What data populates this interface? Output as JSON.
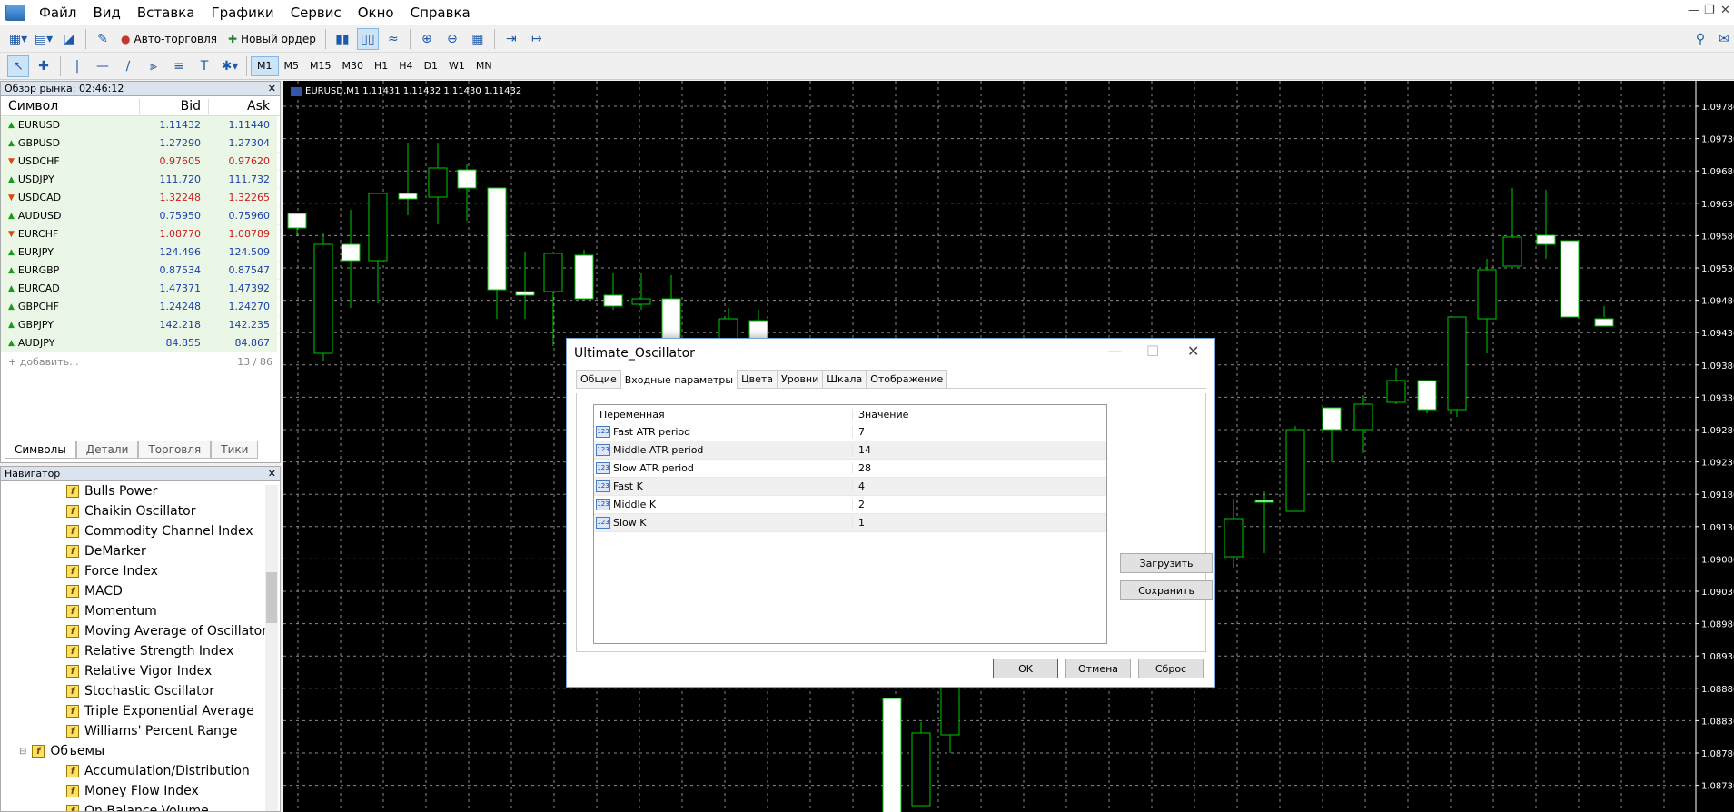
{
  "menu": [
    "Файл",
    "Вид",
    "Вставка",
    "Графики",
    "Сервис",
    "Окно",
    "Справка"
  ],
  "toolbar": {
    "auto_trading": "Авто-торговля",
    "new_order": "Новый ордер"
  },
  "timeframes": [
    "M1",
    "M5",
    "M15",
    "M30",
    "H1",
    "H4",
    "D1",
    "W1",
    "MN"
  ],
  "market_watch": {
    "title": "Обзор рынка: 02:46:12",
    "col_symbol": "Символ",
    "col_bid": "Bid",
    "col_ask": "Ask",
    "rows": [
      {
        "symbol": "EURUSD",
        "bid": "1.11432",
        "ask": "1.11440",
        "dir": "up",
        "color": "blue"
      },
      {
        "symbol": "GBPUSD",
        "bid": "1.27290",
        "ask": "1.27304",
        "dir": "up",
        "color": "blue"
      },
      {
        "symbol": "USDCHF",
        "bid": "0.97605",
        "ask": "0.97620",
        "dir": "down",
        "color": "red"
      },
      {
        "symbol": "USDJPY",
        "bid": "111.720",
        "ask": "111.732",
        "dir": "up",
        "color": "blue"
      },
      {
        "symbol": "USDCAD",
        "bid": "1.32248",
        "ask": "1.32265",
        "dir": "down",
        "color": "red"
      },
      {
        "symbol": "AUDUSD",
        "bid": "0.75950",
        "ask": "0.75960",
        "dir": "up",
        "color": "blue"
      },
      {
        "symbol": "EURCHF",
        "bid": "1.08770",
        "ask": "1.08789",
        "dir": "down",
        "color": "red"
      },
      {
        "symbol": "EURJPY",
        "bid": "124.496",
        "ask": "124.509",
        "dir": "up",
        "color": "blue"
      },
      {
        "symbol": "EURGBP",
        "bid": "0.87534",
        "ask": "0.87547",
        "dir": "up",
        "color": "blue"
      },
      {
        "symbol": "EURCAD",
        "bid": "1.47371",
        "ask": "1.47392",
        "dir": "up",
        "color": "blue"
      },
      {
        "symbol": "GBPCHF",
        "bid": "1.24248",
        "ask": "1.24270",
        "dir": "up",
        "color": "blue"
      },
      {
        "symbol": "GBPJPY",
        "bid": "142.218",
        "ask": "142.235",
        "dir": "up",
        "color": "blue"
      },
      {
        "symbol": "AUDJPY",
        "bid": "84.855",
        "ask": "84.867",
        "dir": "up",
        "color": "blue"
      }
    ],
    "add_label": "добавить...",
    "count": "13 / 86",
    "tabs": [
      "Символы",
      "Детали",
      "Торговля",
      "Тики"
    ]
  },
  "navigator": {
    "title": "Навигатор",
    "items": [
      {
        "label": "Bulls Power",
        "level": 2
      },
      {
        "label": "Chaikin Oscillator",
        "level": 2
      },
      {
        "label": "Commodity Channel Index",
        "level": 2
      },
      {
        "label": "DeMarker",
        "level": 2
      },
      {
        "label": "Force Index",
        "level": 2
      },
      {
        "label": "MACD",
        "level": 2
      },
      {
        "label": "Momentum",
        "level": 2
      },
      {
        "label": "Moving Average of Oscillator",
        "level": 2
      },
      {
        "label": "Relative Strength Index",
        "level": 2
      },
      {
        "label": "Relative Vigor Index",
        "level": 2
      },
      {
        "label": "Stochastic Oscillator",
        "level": 2
      },
      {
        "label": "Triple Exponential Average",
        "level": 2
      },
      {
        "label": "Williams' Percent Range",
        "level": 2
      },
      {
        "label": "Объемы",
        "level": 1
      },
      {
        "label": "Accumulation/Distribution",
        "level": 2
      },
      {
        "label": "Money Flow Index",
        "level": 2
      },
      {
        "label": "On Balance Volume",
        "level": 2
      }
    ]
  },
  "chart": {
    "label": "EURUSD,M1  1.11431 1.11432 1.11430 1.11432",
    "price_labels": [
      "1.09780",
      "1.09730",
      "1.09680",
      "1.09630",
      "1.09580",
      "1.09530",
      "1.09480",
      "1.09430",
      "1.09380",
      "1.09330",
      "1.09280",
      "1.09230",
      "1.09180",
      "1.09130",
      "1.09080",
      "1.09030",
      "1.08980",
      "1.08930",
      "1.08880",
      "1.08830",
      "1.08780",
      "1.08730"
    ]
  },
  "dialog": {
    "title": "Ultimate_Oscillator",
    "tabs": [
      "Общие",
      "Входные параметры",
      "Цвета",
      "Уровни",
      "Шкала",
      "Отображение"
    ],
    "active_tab": 1,
    "col_variable": "Переменная",
    "col_value": "Значение",
    "params": [
      {
        "name": "Fast ATR period",
        "value": "7"
      },
      {
        "name": "Middle ATR period",
        "value": "14"
      },
      {
        "name": "Slow ATR period",
        "value": "28"
      },
      {
        "name": "Fast K",
        "value": "4"
      },
      {
        "name": "Middle K",
        "value": "2"
      },
      {
        "name": "Slow K",
        "value": "1"
      }
    ],
    "load_button": "Загрузить",
    "save_button": "Сохранить",
    "ok_button": "OK",
    "cancel_button": "Отмена",
    "reset_button": "Сброс"
  }
}
